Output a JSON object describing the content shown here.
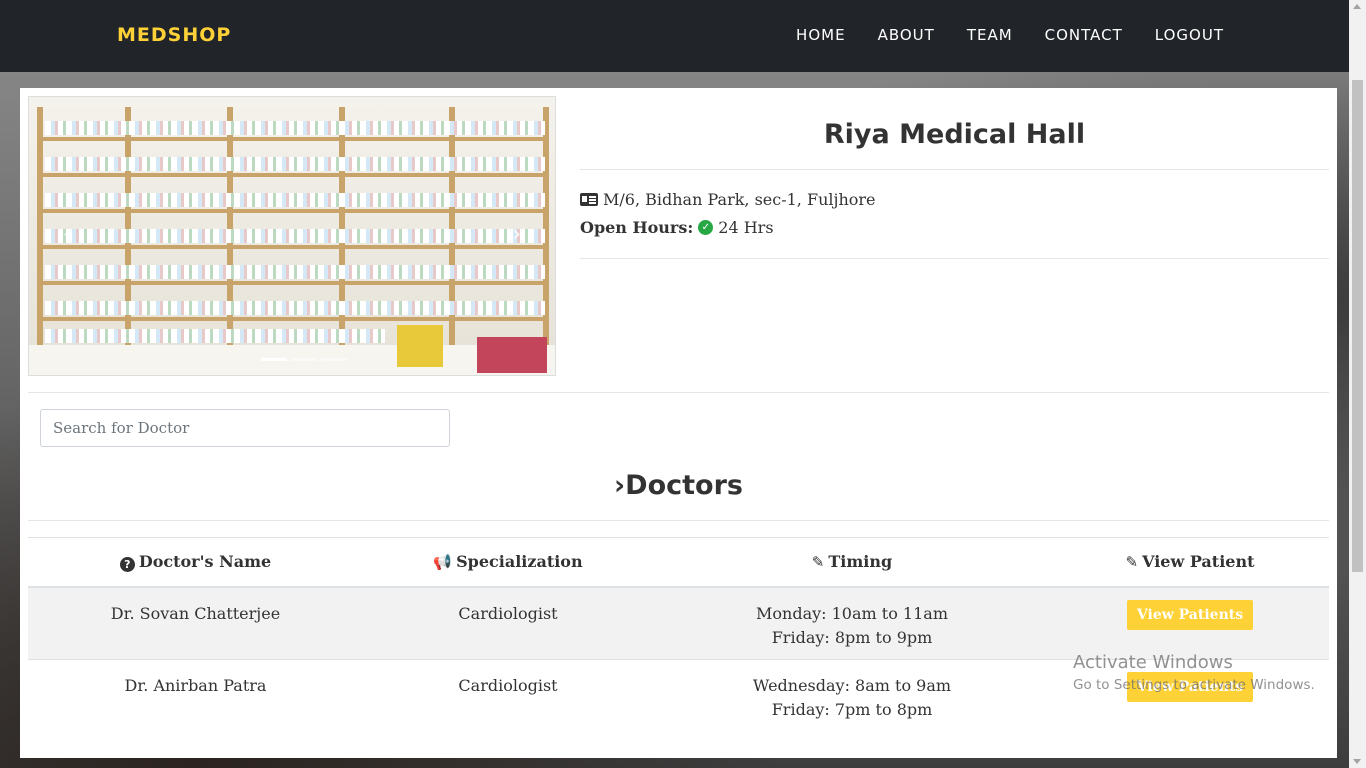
{
  "nav": {
    "brand": "MEDSHOP",
    "items": [
      "HOME",
      "ABOUT",
      "TEAM",
      "CONTACT",
      "LOGOUT"
    ]
  },
  "shop": {
    "name": "Riya Medical Hall",
    "address": "M/6, Bidhan Park, sec-1, Fuljhore",
    "open_hours_label": "Open Hours:",
    "open_hours_value": "24 Hrs"
  },
  "carousel": {
    "prev_icon": "‹",
    "next_icon": "›"
  },
  "search": {
    "placeholder": "Search for Doctor"
  },
  "doctors": {
    "heading": "Doctors",
    "columns": [
      "Doctor's Name",
      "Specialization",
      "Timing",
      "View Patient"
    ],
    "rows": [
      {
        "name": "Dr. Sovan Chatterjee",
        "specialization": "Cardiologist",
        "timing_1": "Monday: 10am to 11am",
        "timing_2": "Friday: 8pm to 9pm",
        "button": "View Patients"
      },
      {
        "name": "Dr. Anirban Patra",
        "specialization": "Cardiologist",
        "timing_1": "Wednesday: 8am to 9am",
        "timing_2": "Friday: 7pm to 8pm",
        "button": "View Patients"
      }
    ]
  },
  "watermark": {
    "line1": "Activate Windows",
    "line2": "Go to Settings to activate Windows."
  },
  "colors": {
    "brand": "#fed136",
    "navbar": "#212529",
    "check": "#28a745"
  }
}
